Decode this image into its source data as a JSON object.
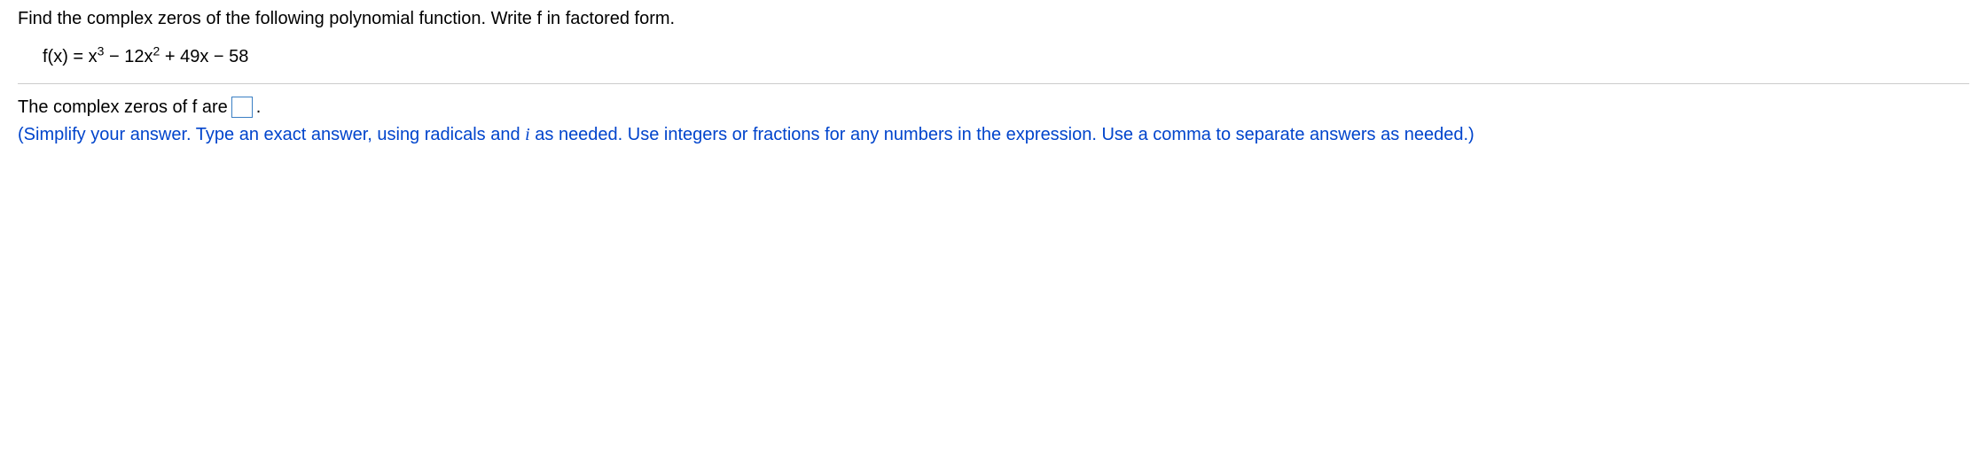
{
  "question": {
    "prompt": "Find the complex zeros of the following polynomial function. Write f in factored form.",
    "equation_prefix": "f(x) = x",
    "equation_exp1": "3",
    "equation_mid1": " − 12x",
    "equation_exp2": "2",
    "equation_suffix": " + 49x − 58"
  },
  "answer": {
    "label_before": "The complex zeros of f are ",
    "label_after": ".",
    "instruction_part1": "(Simplify your answer. Type an exact answer, using radicals and ",
    "instruction_i": "i",
    "instruction_part2": " as needed. Use integers or fractions for any numbers in the expression. Use a comma to separate answers as needed.)"
  }
}
